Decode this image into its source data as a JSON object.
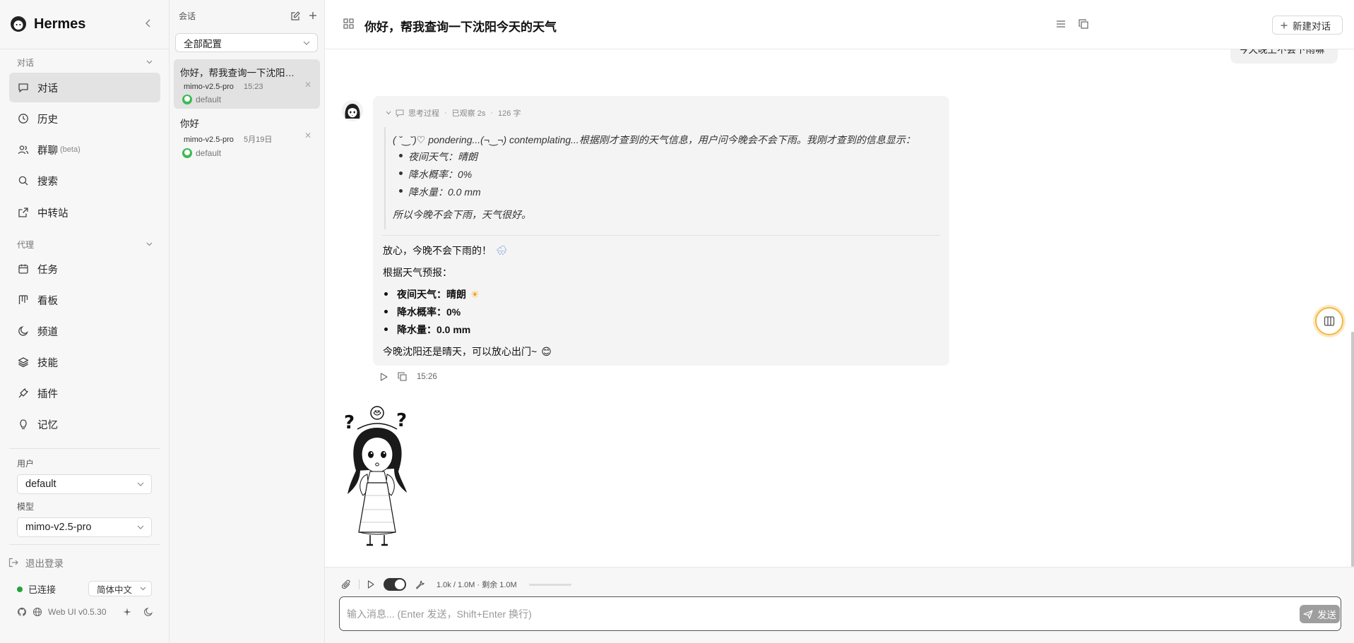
{
  "app": {
    "name": "Hermes"
  },
  "sidebar": {
    "section_chat": "对话",
    "chat_items": [
      {
        "label": "对话",
        "icon": "chat-icon",
        "active": true
      },
      {
        "label": "历史",
        "icon": "clock-icon"
      },
      {
        "label": "群聊",
        "badge": "(beta)",
        "icon": "users-icon"
      },
      {
        "label": "搜索",
        "icon": "search-icon"
      },
      {
        "label": "中转站",
        "icon": "external-link-icon"
      }
    ],
    "section_agent": "代理",
    "agent_items": [
      {
        "label": "任务",
        "icon": "calendar-icon"
      },
      {
        "label": "看板",
        "icon": "kanban-icon"
      },
      {
        "label": "频道",
        "icon": "moon-icon"
      },
      {
        "label": "技能",
        "icon": "layers-icon"
      },
      {
        "label": "插件",
        "icon": "plug-icon"
      },
      {
        "label": "记忆",
        "icon": "lightbulb-icon"
      }
    ],
    "user_label": "用户",
    "user_value": "default",
    "model_label": "模型",
    "model_value": "mimo-v2.5-pro",
    "logout": "退出登录",
    "status": "已连接",
    "status_color": "#22a33d",
    "language": "简体中文",
    "version": "Web UI v0.5.30"
  },
  "conversations": {
    "header": "会话",
    "filter": "全部配置",
    "items": [
      {
        "title": "你好，帮我查询一下沈阳今天的天气",
        "model": "mimo-v2.5-pro",
        "time": "15:23",
        "profile": "default",
        "active": true
      },
      {
        "title": "你好",
        "model": "mimo-v2.5-pro",
        "time": "5月19日",
        "profile": "default"
      }
    ]
  },
  "header": {
    "title": "你好，帮我查询一下沈阳今天的天气",
    "new_chat": "新建对话"
  },
  "chat": {
    "prev_user_message": "今天晚上不会下雨嘛",
    "thinking": {
      "label": "思考过程",
      "elapsed": "已观察 2s",
      "chars": "126 字",
      "intro": "( ˘‿˘)♡ pondering...(¬‿¬) contemplating...根据刚才查到的天气信息，用户问今晚会不会下雨。我刚才查到的信息显示：",
      "items": [
        "夜间天气：晴朗",
        "降水概率：0%",
        "降水量：0.0 mm"
      ],
      "conclusion": "所以今晚不会下雨，天气很好。"
    },
    "answer": {
      "line1": "放心，今晚不会下雨的！",
      "line1_emoji": "🌧",
      "line2": "根据天气预报：",
      "items": [
        {
          "label": "夜间天气：",
          "value": "晴朗",
          "emoji": "☀"
        },
        {
          "label": "降水概率：",
          "value": "0%"
        },
        {
          "label": "降水量：",
          "value": "0.0 mm"
        }
      ],
      "closing": "今晚沈阳还是晴天，可以放心出门~",
      "closing_emoji": "😊"
    },
    "timestamp": "15:26"
  },
  "composer": {
    "tokens": "1.0k / 1.0M · 剩余 1.0M",
    "placeholder": "输入消息... (Enter 发送，Shift+Enter 换行)",
    "value": "",
    "send": "发送"
  },
  "colors": {
    "accent_ring": "#f0b847",
    "active_nav": "#e3e3e3",
    "send_button": "#9e9e9e"
  }
}
